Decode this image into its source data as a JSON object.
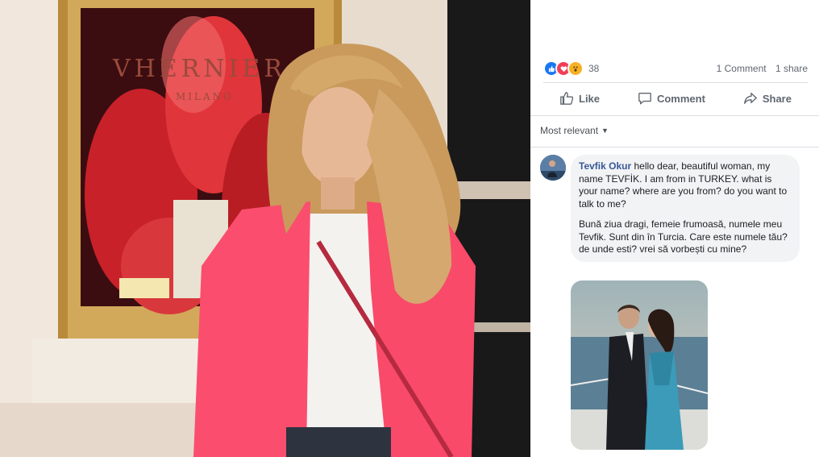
{
  "post_photo": {
    "sign_text": "VHERNIER",
    "sign_sub": "MILANO"
  },
  "stats": {
    "reaction_icons": [
      "like-icon",
      "love-icon",
      "wow-icon"
    ],
    "reaction_colors": [
      "#1877f2",
      "#f33e58",
      "#f7b125"
    ],
    "reaction_count": "38",
    "comments": "1 Comment",
    "shares": "1 share"
  },
  "actions": {
    "like": "Like",
    "comment": "Comment",
    "share": "Share"
  },
  "comments_filter": "Most relevant",
  "comment": {
    "author": "Tevfik Okur",
    "text_en": "hello dear, beautiful woman, my name TEVFİK. I am from in TURKEY. what is your name? where are you from? do you want to talk to me?",
    "text_ro": "Bună ziua dragi, femeie frumoasă, numele meu Tevfik. Sunt din în Turcia. Care este numele tău? de unde esti? vrei să vorbești cu mine?"
  },
  "colors": {
    "link": "#385898",
    "muted": "#606770",
    "bubble": "#f2f3f5"
  }
}
